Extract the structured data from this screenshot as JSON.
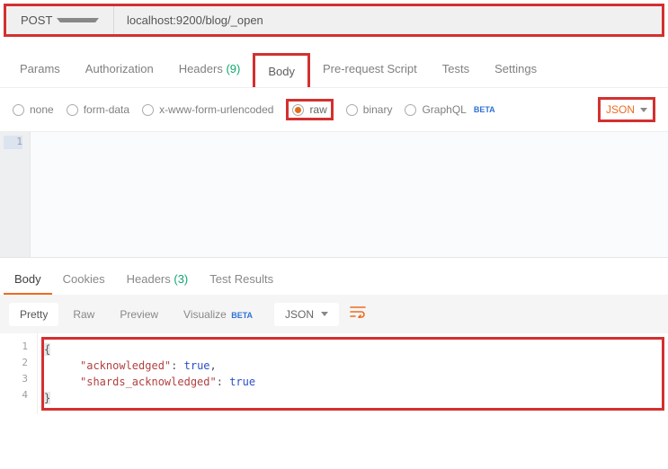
{
  "request": {
    "method": "POST",
    "url": "localhost:9200/blog/_open"
  },
  "tabs": {
    "params": "Params",
    "auth": "Authorization",
    "headers_label": "Headers",
    "headers_count": "(9)",
    "body": "Body",
    "prerequest": "Pre-request Script",
    "tests": "Tests",
    "settings": "Settings"
  },
  "body_types": {
    "none": "none",
    "formdata": "form-data",
    "urlencoded": "x-www-form-urlencoded",
    "raw": "raw",
    "binary": "binary",
    "graphql": "GraphQL",
    "beta": "BETA",
    "format": "JSON"
  },
  "editor": {
    "line1": "1"
  },
  "response_tabs": {
    "body": "Body",
    "cookies": "Cookies",
    "headers_label": "Headers",
    "headers_count": "(3)",
    "testresults": "Test Results"
  },
  "response_toolbar": {
    "pretty": "Pretty",
    "raw": "Raw",
    "preview": "Preview",
    "visualize": "Visualize",
    "beta": "BETA",
    "format": "JSON"
  },
  "response_body": {
    "lines": {
      "l1": "1",
      "l2": "2",
      "l3": "3",
      "l4": "4"
    },
    "brace_open": "{",
    "k1": "\"acknowledged\"",
    "colon": ":",
    "sp": " ",
    "v1": "true",
    "comma": ",",
    "k2": "\"shards_acknowledged\"",
    "v2": "true",
    "brace_close": "}"
  },
  "chart_data": {
    "type": "table",
    "title": "Response JSON",
    "rows": [
      {
        "key": "acknowledged",
        "value": true
      },
      {
        "key": "shards_acknowledged",
        "value": true
      }
    ]
  }
}
